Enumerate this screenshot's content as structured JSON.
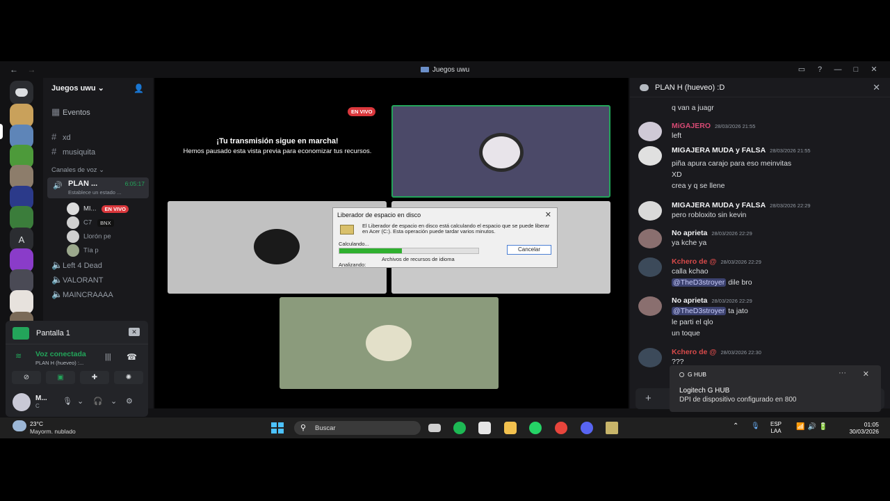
{
  "window": {
    "title": "Juegos uwu",
    "back": "←",
    "forward": "→"
  },
  "servers": [
    {
      "name": "direct-messages",
      "color": "#2b2d31"
    },
    {
      "name": "server-1",
      "color": "#c9a15b"
    },
    {
      "name": "server-2",
      "color": "#5e85b8"
    },
    {
      "name": "server-3",
      "color": "#4d9a3a"
    },
    {
      "name": "server-4",
      "color": "#8d7d6b"
    },
    {
      "name": "server-5",
      "color": "#2b3a8a"
    },
    {
      "name": "server-6",
      "color": "#3b7d3b"
    },
    {
      "name": "server-a",
      "letter": "A"
    },
    {
      "name": "server-8",
      "color": "#8a3cc9"
    },
    {
      "name": "server-9",
      "color": "#4a4a55"
    },
    {
      "name": "server-10",
      "color": "#e7e2dd"
    },
    {
      "name": "server-11",
      "color": "#7a6a58"
    }
  ],
  "sidebar": {
    "server_name": "Juegos uwu",
    "events": "Eventos",
    "text_channels": [
      "xd",
      "musiquita"
    ],
    "voice_category": "Canales de voz",
    "active_voice": {
      "name": "PLAN ...",
      "timer": "6:05:17",
      "status": "Establece un estado ..."
    },
    "voice_users": [
      {
        "name": "MI...",
        "badge": "EN VIVO",
        "color": "#dcdcdc"
      },
      {
        "name": "C7",
        "badge": "BNX",
        "color": "#d0d0d0"
      },
      {
        "name": "Llorón pe",
        "color": "#cfcfcf"
      },
      {
        "name": "Tía p",
        "color": "#9ba88c"
      }
    ],
    "voice_channels": [
      "Left 4 Dead",
      "VALORANT",
      "MAINCRAAAA"
    ]
  },
  "panel": {
    "screen_share": "Pantalla 1",
    "voice_connected": "Voz conectada",
    "voice_channel": "PLAN H (hueveo) :...",
    "user_name": "M...",
    "user_status": "C"
  },
  "stage": {
    "live_badge": "EN VIVO",
    "paused_title": "¡Tu transmisión sigue en marcha!",
    "paused_text": "Hemos pausado esta vista previa para economizar tus recursos."
  },
  "dialog": {
    "title": "Liberador de espacio en disco",
    "message": "El Liberador de espacio en disco está calculando el espacio que se puede liberar en Acer (C:). Esta operación puede tardar varios minutos.",
    "calculating": "Calculando...",
    "progress": 0.45,
    "cancel": "Cancelar",
    "current_file": "Archivos de recursos de idioma",
    "analyzing": "Analizando:"
  },
  "chat": {
    "title": "PLAN H (hueveo) :D",
    "messages": [
      {
        "author": "",
        "time": "",
        "lines": [
          "q van a juagr"
        ]
      },
      {
        "author": "MiGAJERO",
        "author_color": "#d84a74",
        "time": "28/03/2026 21:55",
        "lines": [
          "left"
        ],
        "avatar": "#cfc9d6"
      },
      {
        "author": "MIGAJERA MUDA y FALSA",
        "author_color": "#f2f3f5",
        "time": "28/03/2026 21:55",
        "lines": [
          "piña apura carajo para eso meinvitas",
          "XD",
          "crea y q se llene"
        ],
        "avatar": "#e0e0e0"
      },
      {
        "author": "MIGAJERA MUDA y FALSA",
        "author_color": "#f2f3f5",
        "time": "28/03/2026 22:29",
        "lines": [
          "pero robloxito sin kevin"
        ],
        "avatar": "#d9d9d9"
      },
      {
        "author": "No aprieta",
        "author_color": "#f2f3f5",
        "time": "28/03/2026 22:29",
        "lines": [
          "ya kche ya"
        ],
        "avatar": "#8a6f6f"
      },
      {
        "author": "Kchero de @",
        "author_color": "#d84a4a",
        "time": "28/03/2026 22:29",
        "lines": [
          "calla kchao",
          "@TheD3stroyer dile bro"
        ],
        "avatar": "#3c4a5a"
      },
      {
        "author": "No aprieta",
        "author_color": "#f2f3f5",
        "time": "28/03/2026 22:29",
        "lines": [
          "@TheD3stroyer ta jato",
          "le parti el qlo",
          "un toque"
        ],
        "avatar": "#8a6f6f"
      },
      {
        "author": "Kchero de @",
        "author_color": "#d84a4a",
        "time": "28/03/2026 22:30",
        "lines": [
          "???"
        ],
        "avatar": "#3c4a5a"
      }
    ],
    "mention": "@TheD3stroyer",
    "line_dile": "dile bro",
    "line_jato": "ta jato"
  },
  "toast": {
    "app": "G HUB",
    "title": "Logitech G HUB",
    "body": "DPI de dispositivo configurado en 800"
  },
  "taskbar": {
    "temp": "23°C",
    "weather": "Mayorm. nublado",
    "search": "Buscar",
    "lang1": "ESP",
    "lang2": "LAA",
    "time": "01:05",
    "date": "30/03/2026"
  }
}
